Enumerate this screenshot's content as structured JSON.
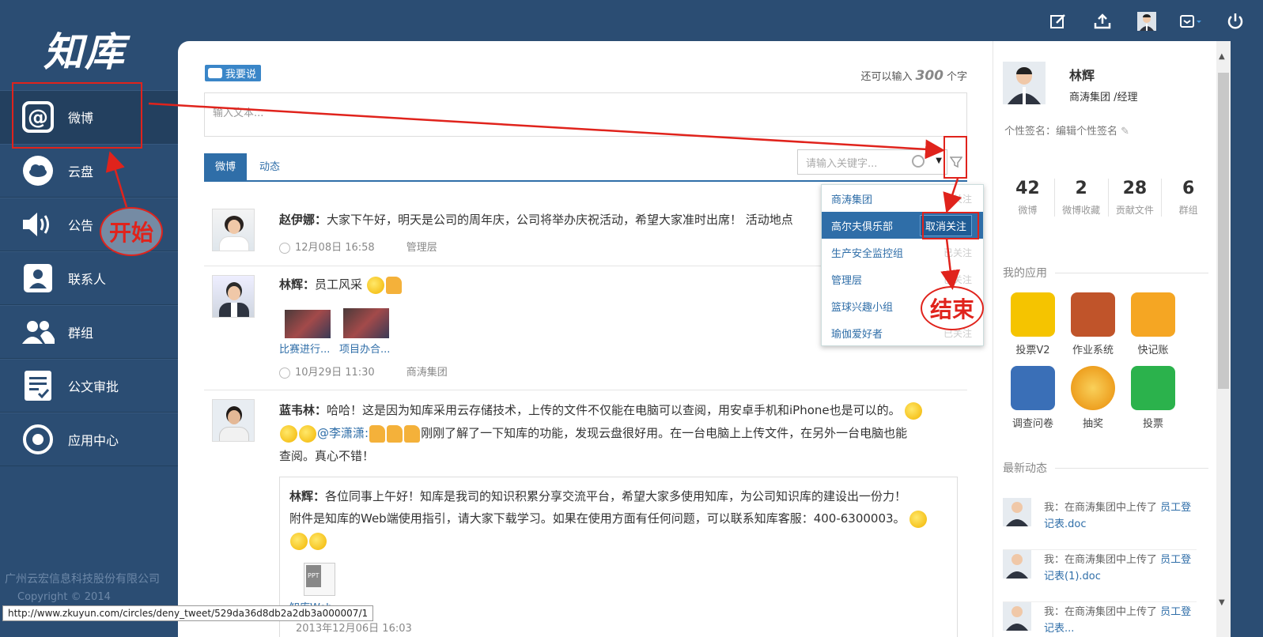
{
  "sidebar": {
    "logo": "知库",
    "items": [
      {
        "label": "微博",
        "icon": "at-icon"
      },
      {
        "label": "云盘",
        "icon": "cloud-icon"
      },
      {
        "label": "公告",
        "icon": "speaker-icon"
      },
      {
        "label": "联系人",
        "icon": "contact-icon"
      },
      {
        "label": "群组",
        "icon": "group-icon"
      },
      {
        "label": "公文审批",
        "icon": "document-check-icon"
      },
      {
        "label": "应用中心",
        "icon": "app-center-icon"
      }
    ],
    "company": "广州云宏信息科技股份有限公司",
    "copyright": "Copyright  ©  2014"
  },
  "annotations": {
    "start": "开始",
    "end": "结束"
  },
  "composer": {
    "badge": "我要说",
    "remaining_prefix": "还可以输入",
    "remaining_count": "300",
    "remaining_suffix": "个字",
    "placeholder": "输入文本..."
  },
  "tabs": [
    "微博",
    "动态"
  ],
  "search": {
    "placeholder": "请输入关键字..."
  },
  "dropdown": {
    "items": [
      {
        "name": "商涛集团",
        "action": "已关注"
      },
      {
        "name": "高尔夫俱乐部",
        "action": "取消关注"
      },
      {
        "name": "生产安全监控组",
        "action": "已关注"
      },
      {
        "name": "管理层",
        "action": "已关注"
      },
      {
        "name": "篮球兴趣小组",
        "action": ""
      },
      {
        "name": "瑜伽爱好者",
        "action": "已关注"
      }
    ]
  },
  "posts": [
    {
      "author": "赵伊娜：",
      "text": "大家下午好，明天是公司的周年庆，公司将举办庆祝活动，希望大家准时出席！ 活动地点",
      "time": "12月08日 16:58",
      "group": "管理层"
    },
    {
      "author": "林辉：",
      "text": "员工风采",
      "captions": [
        "比赛进行...",
        "项目办合..."
      ],
      "time": "10月29日 11:30",
      "group": "商涛集团"
    },
    {
      "author": "蓝韦林：",
      "text1": "哈哈！这是因为知库采用云存储技术，上传的文件不仅能在电脑可以查阅，用安卓手机和iPhone也是可以的。",
      "mention": "@李潇潇:",
      "text2": "刚刚了解了一下知库的功能，发现云盘很好用。在一台电脑上上传文件，在另外一台电脑也能",
      "text3": "查阅。真心不错！",
      "quote_author": "林辉：",
      "quote1": "各位同事上午好！知库是我司的知识积累分享交流平台，希望大家多使用知库，为公司知识库的建设出一份力！",
      "quote2": "附件是知库的Web端使用指引，请大家下载学习。如果在使用方面有任何问题，可以联系知库客服：400-6300003。",
      "ppt_label": "PPT",
      "file_label": "知库Web",
      "quote_time": "2013年12月06日 16:03"
    }
  ],
  "profile": {
    "name": "林辉",
    "title": "商涛集团 /经理",
    "signature": "个性签名：编辑个性签名",
    "stats": [
      {
        "n": "42",
        "l": "微博"
      },
      {
        "n": "2",
        "l": "微博收藏"
      },
      {
        "n": "28",
        "l": "贡献文件"
      },
      {
        "n": "6",
        "l": "群组"
      }
    ],
    "apps_title": "我的应用",
    "apps": [
      {
        "label": "投票V2",
        "color": "#f5c400"
      },
      {
        "label": "作业系统",
        "color": "#c0542a"
      },
      {
        "label": "快记账",
        "color": "#f5a623"
      },
      {
        "label": "调查问卷",
        "color": "#3a6fb7"
      },
      {
        "label": "抽奖",
        "color": "#f2a20f"
      },
      {
        "label": "投票",
        "color": "#2bb24c"
      }
    ],
    "feed_title": "最新动态",
    "feed": [
      {
        "text": "我：在商涛集团中上传了 ",
        "file": "员工登记表.doc"
      },
      {
        "text": "我：在商涛集团中上传了 ",
        "file": "员工登记表(1).doc"
      },
      {
        "text": "我：在商涛集团中上传了 ",
        "file": "员工登记表..."
      }
    ]
  },
  "statusbar": "http://www.zkuyun.com/circles/deny_tweet/529da36d8db2a2db3a000007/1"
}
